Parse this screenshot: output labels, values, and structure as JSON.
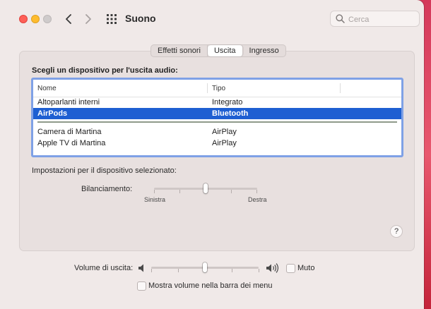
{
  "window": {
    "title": "Suono",
    "search_placeholder": "Cerca"
  },
  "tabs": [
    {
      "label": "Effetti sonori",
      "active": false
    },
    {
      "label": "Uscita",
      "active": true
    },
    {
      "label": "Ingresso",
      "active": false
    }
  ],
  "output": {
    "section_label": "Scegli un dispositivo per l'uscita audio:",
    "columns": [
      "Nome",
      "Tipo"
    ],
    "devices": [
      {
        "name": "Altoparlanti interni",
        "type": "Integrato",
        "selected": false
      },
      {
        "name": "AirPods",
        "type": "Bluetooth",
        "selected": true
      },
      {
        "name": "Camera di Martina",
        "type": "AirPlay",
        "selected": false
      },
      {
        "name": "Apple TV di Martina",
        "type": "AirPlay",
        "selected": false
      }
    ],
    "settings_label": "Impostazioni per il dispositivo selezionato:",
    "balance": {
      "label": "Bilanciamento:",
      "left_label": "Sinistra",
      "right_label": "Destra",
      "value": 0.5
    },
    "help_label": "?"
  },
  "volume": {
    "label": "Volume di uscita:",
    "value": 0.5,
    "mute_label": "Muto",
    "mute_checked": false,
    "show_in_menubar_label": "Mostra volume nella barra dei menu",
    "show_in_menubar_checked": false
  },
  "colors": {
    "selection": "#1e5fd2",
    "focus_ring": "#7fa1e6",
    "close": "#fe5f57",
    "minimize": "#febc2e"
  }
}
